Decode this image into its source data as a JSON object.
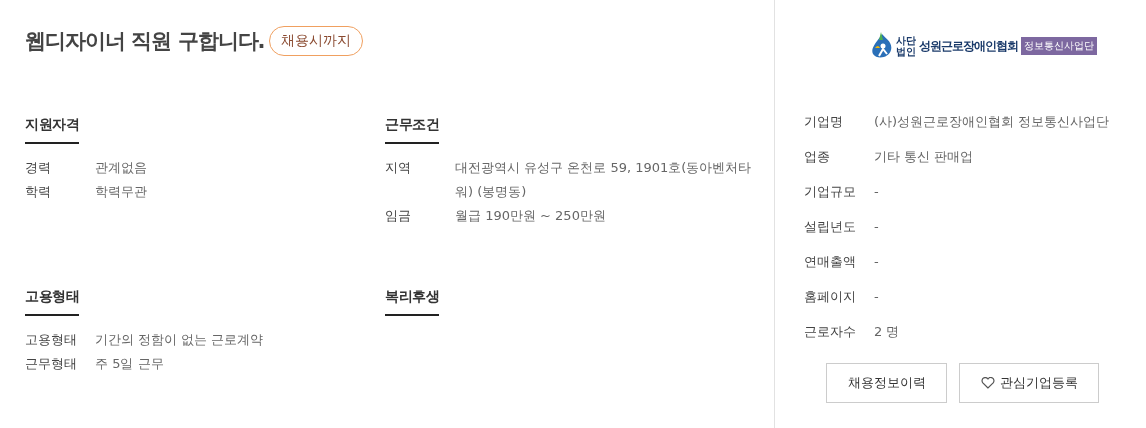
{
  "title": "웹디자이너 직원 구합니다.",
  "deadline_badge": "채용시까지",
  "sections": [
    {
      "heading": "지원자격",
      "rows": [
        {
          "label": "경력",
          "value": "관계없음"
        },
        {
          "label": "학력",
          "value": "학력무관"
        }
      ]
    },
    {
      "heading": "근무조건",
      "rows": [
        {
          "label": "지역",
          "value": "대전광역시 유성구 온천로 59, 1901호(동아벤처타워) (봉명동)"
        },
        {
          "label": "임금",
          "value": "월급 190만원 ~ 250만원"
        }
      ]
    },
    {
      "heading": "고용형태",
      "rows": [
        {
          "label": "고용형태",
          "value": "기간의 정함이 없는 근로계약"
        },
        {
          "label": "근무형태",
          "value": "주 5일 근무"
        }
      ]
    },
    {
      "heading": "복리후생"
    }
  ],
  "company": {
    "logo": {
      "prefix": "사단법인",
      "name": "성원근로장애인협회",
      "division": "정보통신사업단"
    },
    "rows": [
      {
        "label": "기업명",
        "value": "(사)성원근로장애인협회 정보통신사업단"
      },
      {
        "label": "업종",
        "value": "기타 통신 판매업"
      },
      {
        "label": "기업규모",
        "value": "-"
      },
      {
        "label": "설립년도",
        "value": "-"
      },
      {
        "label": "연매출액",
        "value": "-"
      },
      {
        "label": "홈페이지",
        "value": "-"
      },
      {
        "label": "근로자수",
        "value": "2 명"
      }
    ],
    "buttons": [
      {
        "label": "채용정보이력",
        "kind": "plain"
      },
      {
        "label": "관심기업등록",
        "kind": "heart"
      }
    ]
  }
}
